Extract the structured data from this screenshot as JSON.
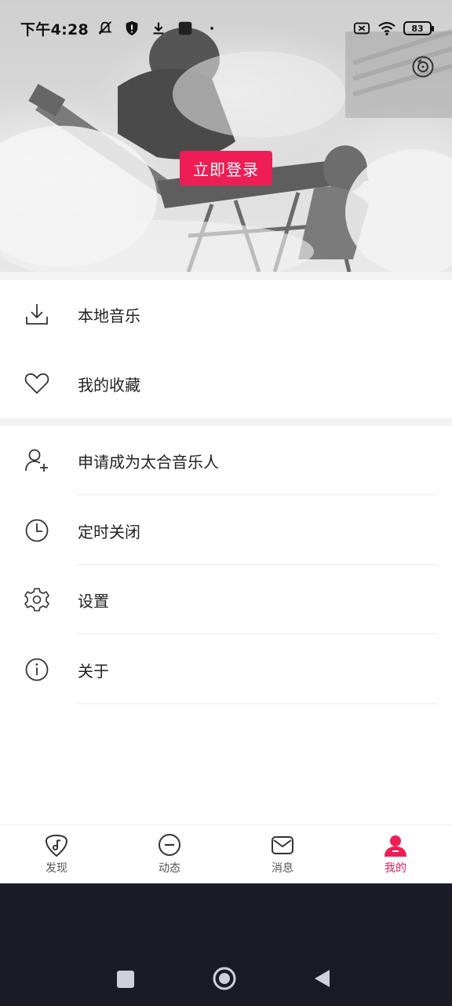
{
  "status_bar": {
    "time": "下午4:28",
    "battery": "83"
  },
  "header": {
    "login_button": "立即登录",
    "brand_color": "#ee1d54"
  },
  "menu": {
    "group1": [
      {
        "label": "本地音乐",
        "icon": "download-icon"
      },
      {
        "label": "我的收藏",
        "icon": "heart-icon"
      }
    ],
    "group2": [
      {
        "label": "申请成为太合音乐人",
        "icon": "add-user-icon"
      },
      {
        "label": "定时关闭",
        "icon": "clock-icon"
      },
      {
        "label": "设置",
        "icon": "gear-icon"
      },
      {
        "label": "关于",
        "icon": "info-icon"
      }
    ]
  },
  "bottom_nav": {
    "items": [
      {
        "label": "发现",
        "icon": "guitar-pick-icon"
      },
      {
        "label": "动态",
        "icon": "chat-bubble-icon"
      },
      {
        "label": "消息",
        "icon": "mail-icon"
      },
      {
        "label": "我的",
        "icon": "user-icon",
        "active": true
      }
    ]
  }
}
